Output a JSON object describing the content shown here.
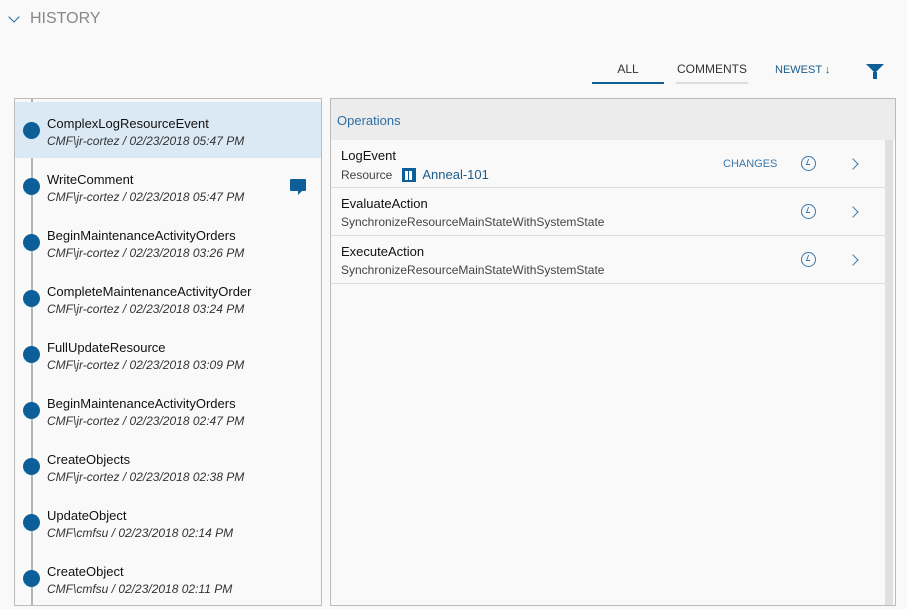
{
  "header": {
    "title": "HISTORY"
  },
  "tabs": [
    {
      "label": "ALL"
    },
    {
      "label": "COMMENTS"
    }
  ],
  "sort": {
    "label": "NEWEST ↓"
  },
  "history": [
    {
      "name": "ComplexLogResourceEvent",
      "meta": "CMF\\jr-cortez / 02/23/2018 05:47 PM"
    },
    {
      "name": "WriteComment",
      "meta": "CMF\\jr-cortez / 02/23/2018 05:47 PM"
    },
    {
      "name": "BeginMaintenanceActivityOrders",
      "meta": "CMF\\jr-cortez / 02/23/2018 03:26 PM"
    },
    {
      "name": "CompleteMaintenanceActivityOrder",
      "meta": "CMF\\jr-cortez / 02/23/2018 03:24 PM"
    },
    {
      "name": "FullUpdateResource",
      "meta": "CMF\\jr-cortez / 02/23/2018 03:09 PM"
    },
    {
      "name": "BeginMaintenanceActivityOrders",
      "meta": "CMF\\jr-cortez / 02/23/2018 02:47 PM"
    },
    {
      "name": "CreateObjects",
      "meta": "CMF\\jr-cortez / 02/23/2018 02:38 PM"
    },
    {
      "name": "UpdateObject",
      "meta": "CMF\\cmfsu / 02/23/2018 02:14 PM"
    },
    {
      "name": "CreateObject",
      "meta": "CMF\\cmfsu / 02/23/2018 02:11 PM"
    }
  ],
  "operations": {
    "title": "Operations",
    "rows": [
      {
        "name": "LogEvent",
        "type": "Resource",
        "link": "Anneal-101",
        "changes": "CHANGES"
      },
      {
        "name": "EvaluateAction",
        "sub": "SynchronizeResourceMainStateWithSystemState"
      },
      {
        "name": "ExecuteAction",
        "sub": "SynchronizeResourceMainStateWithSystemState"
      }
    ]
  }
}
